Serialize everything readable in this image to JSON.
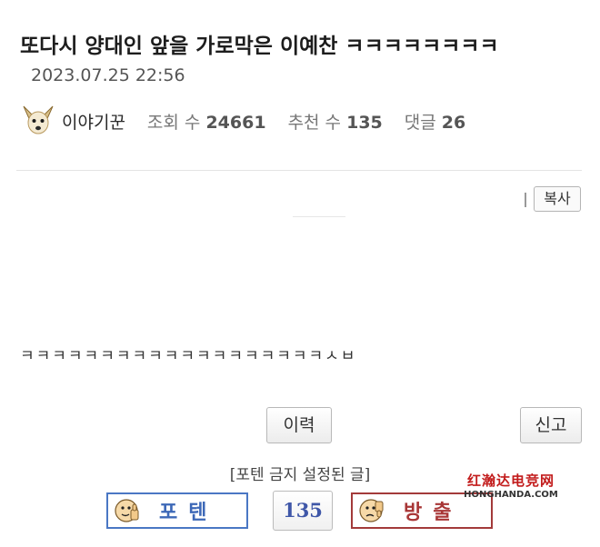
{
  "post": {
    "title": "또다시 양대인 앞을 가로막은 이예찬 ㅋㅋㅋㅋㅋㅋㅋㅋ",
    "date": "2023.07.25 22:56",
    "author": "이야기꾼",
    "views_label": "조회 수",
    "views": "24661",
    "recommend_label": "추천 수",
    "recommend": "135",
    "comments_label": "댓글",
    "comments": "26",
    "body": "ㅋㅋㅋㅋㅋㅋㅋㅋㅋㅋㅋㅋㅋㅋㅋㅋㅋㅋㅋㅅㅂ"
  },
  "buttons": {
    "copy": "복사",
    "history": "이력",
    "report": "신고"
  },
  "votes": {
    "notice": "[포텐 금지 설정된 글]",
    "up_label": "포텐",
    "count": "135",
    "down_label": "방출"
  },
  "watermark": {
    "text_cn": "红瀚达电竞网",
    "url": "HONGHANDA.COM"
  },
  "icons": {
    "avatar": "dog-avatar-icon",
    "up": "thumbs-up-face-icon",
    "down": "thumbs-down-face-icon"
  },
  "colors": {
    "vote_up": "#4a77c4",
    "vote_down": "#a33a3a",
    "count": "#3f57a8",
    "watermark": "#c21b1b"
  }
}
